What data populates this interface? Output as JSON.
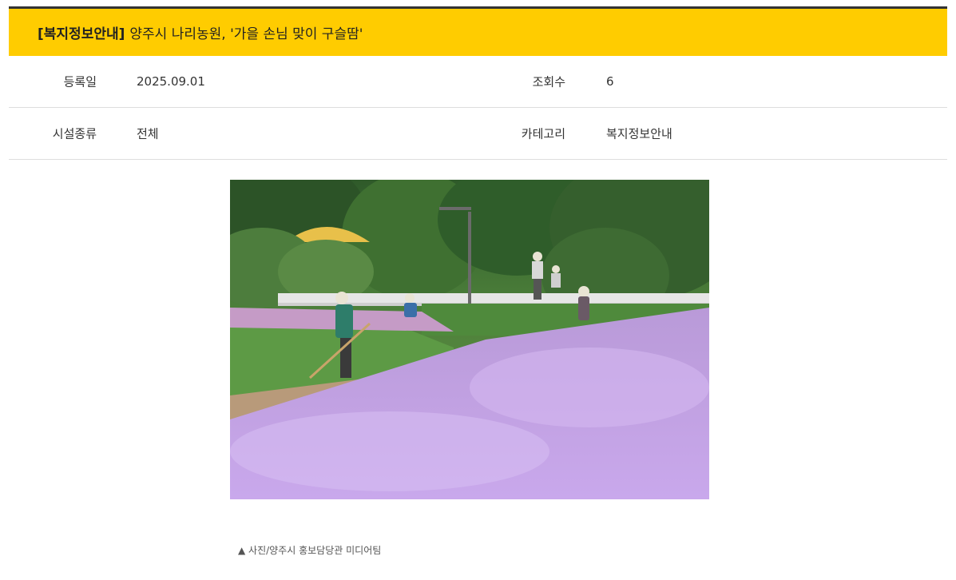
{
  "post": {
    "category": "[복지정보안내]",
    "title": "양주시 나리농원, '가을 손님 맞이 구슬땀'"
  },
  "info": {
    "date_label": "등록일",
    "date_value": "2025.09.01",
    "views_label": "조회수",
    "views_value": "6",
    "facility_label": "시설종류",
    "facility_value": "전체",
    "category_label": "카테고리",
    "category_value": "복지정보안내"
  },
  "content": {
    "caption": "▲ 사진/양주시 홍보담당관 미디어팀"
  },
  "colors": {
    "title_bar": "#ffcc00",
    "border_top": "#333333",
    "row_border": "#dddddd"
  }
}
